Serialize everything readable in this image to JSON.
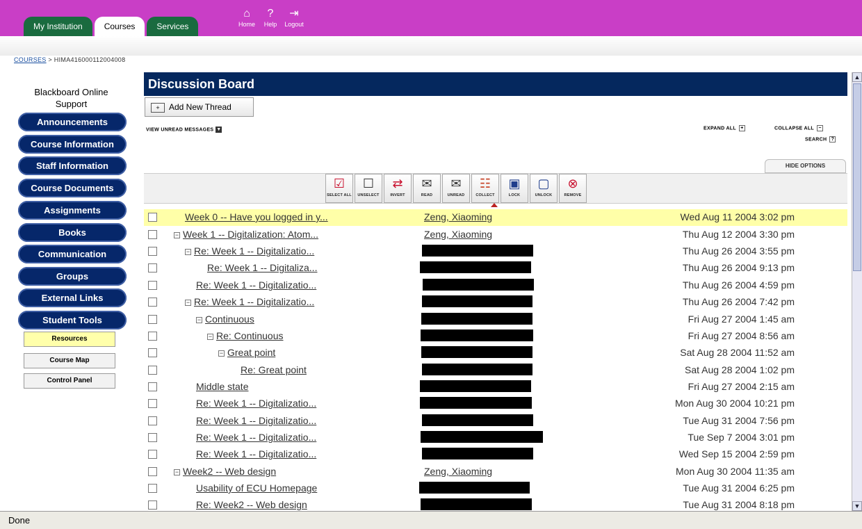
{
  "tabs": [
    {
      "label": "My Institution"
    },
    {
      "label": "Courses"
    },
    {
      "label": "Services"
    }
  ],
  "top_icons": [
    {
      "label": "Home",
      "icon": "home-icon"
    },
    {
      "label": "Help",
      "icon": "help-icon"
    },
    {
      "label": "Logout",
      "icon": "logout-icon"
    }
  ],
  "breadcrumb": {
    "link": "COURSES",
    "separator": ">",
    "course_id": "HIMA416000112004008"
  },
  "sidebar": {
    "support_line1": "Blackboard Online",
    "support_line2": "Support",
    "nav": [
      "Announcements",
      "Course Information",
      "Staff Information",
      "Course Documents",
      "Assignments",
      "Books",
      "Communication",
      "Groups",
      "External Links",
      "Student Tools"
    ],
    "sub": [
      "Resources",
      "Course Map",
      "Control Panel"
    ]
  },
  "board": {
    "title": "Discussion Board",
    "add_thread": "Add New Thread",
    "view_unread": "VIEW UNREAD MESSAGES",
    "expand_label": "EXPAND ALL",
    "collapse_label": "COLLAPSE ALL",
    "search_label": "SEARCH",
    "hide_options": "HIDE OPTIONS"
  },
  "toolbar": [
    {
      "label": "SELECT ALL",
      "icon": "select-all-icon"
    },
    {
      "label": "UNSELECT",
      "icon": "unselect-icon"
    },
    {
      "label": "INVERT",
      "icon": "invert-icon"
    },
    {
      "label": "READ",
      "icon": "read-icon"
    },
    {
      "label": "UNREAD",
      "icon": "unread-icon"
    },
    {
      "label": "COLLECT",
      "icon": "collect-icon"
    },
    {
      "label": "LOCK",
      "icon": "lock-icon"
    },
    {
      "label": "UNLOCK",
      "icon": "unlock-icon"
    },
    {
      "label": "REMOVE",
      "icon": "remove-icon"
    }
  ],
  "threads": [
    {
      "subject": "Week 0 -- Have you logged in y...",
      "author": "Zeng, Xiaoming",
      "date": "Wed Aug 11 2004 3:02 pm"
    },
    {
      "subject": "Week 1 -- Digitalization: Atom...",
      "author": "Zeng, Xiaoming",
      "date": "Thu Aug 12 2004 3:30 pm"
    },
    {
      "subject": "Re: Week 1 -- Digitalizatio...",
      "author": "",
      "date": "Thu Aug 26 2004 3:55 pm"
    },
    {
      "subject": "Re: Week 1 -- Digitaliza...",
      "author": "",
      "date": "Thu Aug 26 2004 9:13 pm"
    },
    {
      "subject": "Re: Week 1 -- Digitalizatio...",
      "author": "",
      "date": "Thu Aug 26 2004 4:59 pm"
    },
    {
      "subject": "Re: Week 1 -- Digitalizatio...",
      "author": "",
      "date": "Thu Aug 26 2004 7:42 pm"
    },
    {
      "subject": "Continuous",
      "author": "",
      "date": "Fri Aug 27 2004 1:45 am"
    },
    {
      "subject": "Re: Continuous",
      "author": "",
      "date": "Fri Aug 27 2004 8:56 am"
    },
    {
      "subject": "Great point",
      "author": "",
      "date": "Sat Aug 28 2004 11:52 am"
    },
    {
      "subject": "Re: Great point",
      "author": "",
      "date": "Sat Aug 28 2004 1:02 pm"
    },
    {
      "subject": "Middle state",
      "author": "",
      "date": "Fri Aug 27 2004 2:15 am"
    },
    {
      "subject": "Re: Week 1 -- Digitalizatio...",
      "author": "",
      "date": "Mon Aug 30 2004 10:21 pm"
    },
    {
      "subject": "Re: Week 1 -- Digitalizatio...",
      "author": "",
      "date": "Tue Aug 31 2004 7:56 pm"
    },
    {
      "subject": "Re: Week 1 -- Digitalizatio...",
      "author": "",
      "date": "Tue Sep 7 2004 3:01 pm"
    },
    {
      "subject": "Re: Week 1 -- Digitalizatio...",
      "author": "",
      "date": "Wed Sep 15 2004 2:59 pm"
    },
    {
      "subject": "Week2 -- Web design",
      "author": "Zeng, Xiaoming",
      "date": "Mon Aug 30 2004 11:35 am"
    },
    {
      "subject": "Usability of ECU Homepage",
      "author": "",
      "date": "Tue Aug 31 2004 6:25 pm"
    },
    {
      "subject": "Re: Week2 -- Web design",
      "author": "",
      "date": "Tue Aug 31 2004 8:18 pm"
    }
  ],
  "status": {
    "text": "Done"
  },
  "colors": {
    "topbar": "#c93ec6",
    "tab_green": "#1a6b3f",
    "nav_blue": "#06276a",
    "header_blue": "#05285e",
    "highlight": "#ffffa8"
  }
}
